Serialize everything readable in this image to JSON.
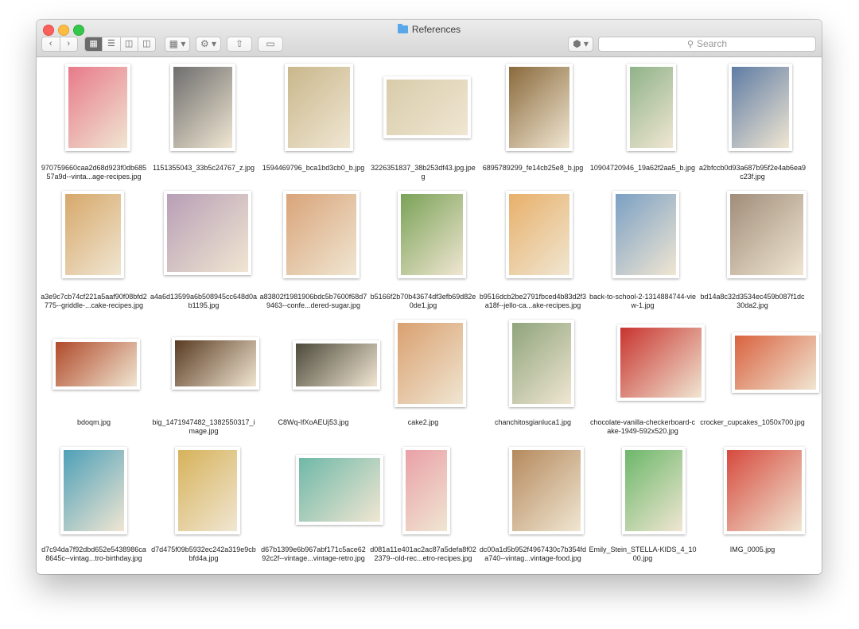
{
  "window": {
    "title": "References"
  },
  "toolbar": {
    "back_icon": "chevron-left-icon",
    "forward_icon": "chevron-right-icon",
    "view_modes": [
      "icon-view",
      "list-view",
      "column-view",
      "cover-flow-view"
    ],
    "arrange_label": "▦ ▾",
    "action_label": "⚙ ▾",
    "share_icon": "share-icon",
    "tag_icon": "tag-icon",
    "dropbox_label": "⬢ ▾",
    "search_placeholder": "Search"
  },
  "files": [
    {
      "name": "970759660caa2d68d923f0db68557a9d--vinta...age-recipes.jpg",
      "color": "#e87a8a"
    },
    {
      "name": "1151355043_33b5c24767_z.jpg",
      "color": "#6e6e6e"
    },
    {
      "name": "1594469796_bca1bd3cb0_b.jpg",
      "color": "#c9b78c"
    },
    {
      "name": "3226351837_38b253df43.jpg.jpeg",
      "color": "#d8ccaa"
    },
    {
      "name": "6895789299_fe14cb25e8_b.jpg",
      "color": "#8a6a3c"
    },
    {
      "name": "10904720946_19a62f2aa5_b.jpg",
      "color": "#8fb38a"
    },
    {
      "name": "a2bfccb0d93a687b95f2e4ab6ea9c23f.jpg",
      "color": "#5f7ca4"
    },
    {
      "name": "a3e9c7cb74cf221a5aaf90f08bfd2775--griddle-...cake-recipes.jpg",
      "color": "#d6a86a"
    },
    {
      "name": "a4a6d13599a6b508945cc648d0ab1195.jpg",
      "color": "#b89fb6"
    },
    {
      "name": "a83802f1981906bdc5b7600f68d79463--confe...dered-sugar.jpg",
      "color": "#d9a47a"
    },
    {
      "name": "b5166f2b70b43674df3efb69d82e0de1.jpg",
      "color": "#7aa257"
    },
    {
      "name": "b9516dcb2be2791fbced4b83d2f3a18f--jello-ca...ake-recipes.jpg",
      "color": "#e8b06a"
    },
    {
      "name": "back-to-school-2-1314884744-view-1.jpg",
      "color": "#7ba0c4"
    },
    {
      "name": "bd14a8c32d3534ec459b087f1dc30da2.jpg",
      "color": "#a08d7a"
    },
    {
      "name": "bdoqm.jpg",
      "color": "#b04a2a"
    },
    {
      "name": "big_1471947482_1382550317_image.jpg",
      "color": "#5a3b22"
    },
    {
      "name": "C8Wq-IfXoAEUj53.jpg",
      "color": "#4d4a3a"
    },
    {
      "name": "cake2.jpg",
      "color": "#d9a070"
    },
    {
      "name": "chanchitosgianluca1.jpg",
      "color": "#8fa47c"
    },
    {
      "name": "chocolate-vanilla-checkerboard-cake-1949-592x520.jpg",
      "color": "#c8342f"
    },
    {
      "name": "crocker_cupcakes_1050x700.jpg",
      "color": "#d9623f"
    },
    {
      "name": "d7c94da7f92dbd652e5438986ca8645c--vintag...tro-birthday.jpg",
      "color": "#4ea0b8"
    },
    {
      "name": "d7d475f09b5932ec242a319e9cbbfd4a.jpg",
      "color": "#d6b25a"
    },
    {
      "name": "d67b1399e6b967abf171c5ace6292c2f--vintage...vintage-retro.jpg",
      "color": "#6fb8a8"
    },
    {
      "name": "d081a11e401ac2ac87a5defa8f022379--old-rec...etro-recipes.jpg",
      "color": "#e9a0a8"
    },
    {
      "name": "dc00a1d5b952f4967430c7b354fda740--vintag...vintage-food.jpg",
      "color": "#b58a5e"
    },
    {
      "name": "Emily_Stein_STELLA-KIDS_4_1000.jpg",
      "color": "#6cb76a"
    },
    {
      "name": "IMG_0005.jpg",
      "color": "#d64a3e"
    }
  ]
}
